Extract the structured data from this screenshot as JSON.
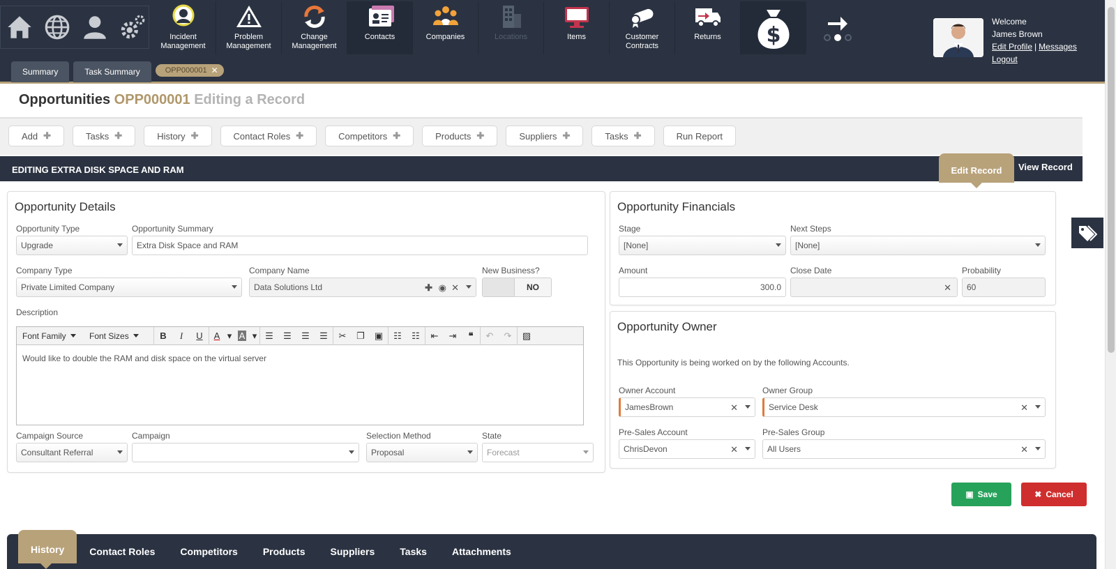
{
  "quick_icons": [
    "home-icon",
    "globe-icon",
    "user-icon",
    "settings-icon"
  ],
  "nav": {
    "items": [
      {
        "label_1": "Incident",
        "label_2": "Management",
        "icon": "incident-icon"
      },
      {
        "label_1": "Problem",
        "label_2": "Management",
        "icon": "warning-icon"
      },
      {
        "label_1": "Change",
        "label_2": "Management",
        "icon": "refresh-icon"
      },
      {
        "label_1": "Contacts",
        "label_2": "",
        "icon": "contacts-icon"
      },
      {
        "label_1": "Companies",
        "label_2": "",
        "icon": "companies-icon"
      },
      {
        "label_1": "Locations",
        "label_2": "",
        "icon": "building-icon"
      },
      {
        "label_1": "Items",
        "label_2": "",
        "icon": "monitor-icon"
      },
      {
        "label_1": "Customer",
        "label_2": "Contracts",
        "icon": "contract-icon"
      },
      {
        "label_1": "Returns",
        "label_2": "",
        "icon": "truck-icon"
      }
    ]
  },
  "user": {
    "welcome": "Welcome",
    "name": "James Brown",
    "edit_profile": "Edit Profile",
    "separator": "|",
    "messages": "Messages",
    "logout": "Logout"
  },
  "top_tabs": {
    "summary": "Summary",
    "task_summary": "Task Summary",
    "record": "OPP000001",
    "close": "✕"
  },
  "page": {
    "module": "Opportunities",
    "code": "OPP000001",
    "mode": "Editing a Record"
  },
  "actions": {
    "add": "Add",
    "tasks": "Tasks",
    "history": "History",
    "contact_roles": "Contact Roles",
    "competitors": "Competitors",
    "products": "Products",
    "suppliers": "Suppliers",
    "tasks2": "Tasks",
    "run_report": "Run Report"
  },
  "section": {
    "title": "EDITING EXTRA DISK SPACE AND RAM",
    "edit_record": "Edit Record",
    "view_record": "View Record"
  },
  "details": {
    "title": "Opportunity Details",
    "opportunity_type_label": "Opportunity Type",
    "opportunity_type": "Upgrade",
    "summary_label": "Opportunity Summary",
    "summary": "Extra Disk Space and RAM",
    "company_type_label": "Company Type",
    "company_type": "Private Limited Company",
    "company_name_label": "Company Name",
    "company_name": "Data Solutions Ltd",
    "new_business_label": "New Business?",
    "new_business": "NO",
    "description_label": "Description",
    "toolbar": {
      "font_family": "Font Family",
      "font_sizes": "Font Sizes"
    },
    "description": "Would like to double the RAM and disk space on the virtual server",
    "campaign_source_label": "Campaign Source",
    "campaign_source": "Consultant Referral",
    "campaign_label": "Campaign",
    "campaign": "",
    "selection_method_label": "Selection Method",
    "selection_method": "Proposal",
    "state_label": "State",
    "state": "Forecast"
  },
  "financials": {
    "title": "Opportunity Financials",
    "stage_label": "Stage",
    "stage": "[None]",
    "next_steps_label": "Next Steps",
    "next_steps": "[None]",
    "amount_label": "Amount",
    "amount": "300.0",
    "close_date_label": "Close Date",
    "close_date": "",
    "probability_label": "Probability",
    "probability": "60"
  },
  "owner": {
    "title": "Opportunity Owner",
    "description": "This Opportunity is being worked on by the following Accounts.",
    "owner_account_label": "Owner Account",
    "owner_account": "JamesBrown",
    "owner_group_label": "Owner Group",
    "owner_group": "Service Desk",
    "presales_account_label": "Pre-Sales Account",
    "presales_account": "ChrisDevon",
    "presales_group_label": "Pre-Sales Group",
    "presales_group": "All Users"
  },
  "buttons": {
    "save": "Save",
    "cancel": "Cancel"
  },
  "bottom_tabs": [
    "History",
    "Contact Roles",
    "Competitors",
    "Products",
    "Suppliers",
    "Tasks",
    "Attachments"
  ],
  "colors": {
    "navy": "#2b3342",
    "gold": "#b8a27a",
    "save": "#27a25a",
    "cancel": "#cf2e2e",
    "required": "#e07b39"
  }
}
